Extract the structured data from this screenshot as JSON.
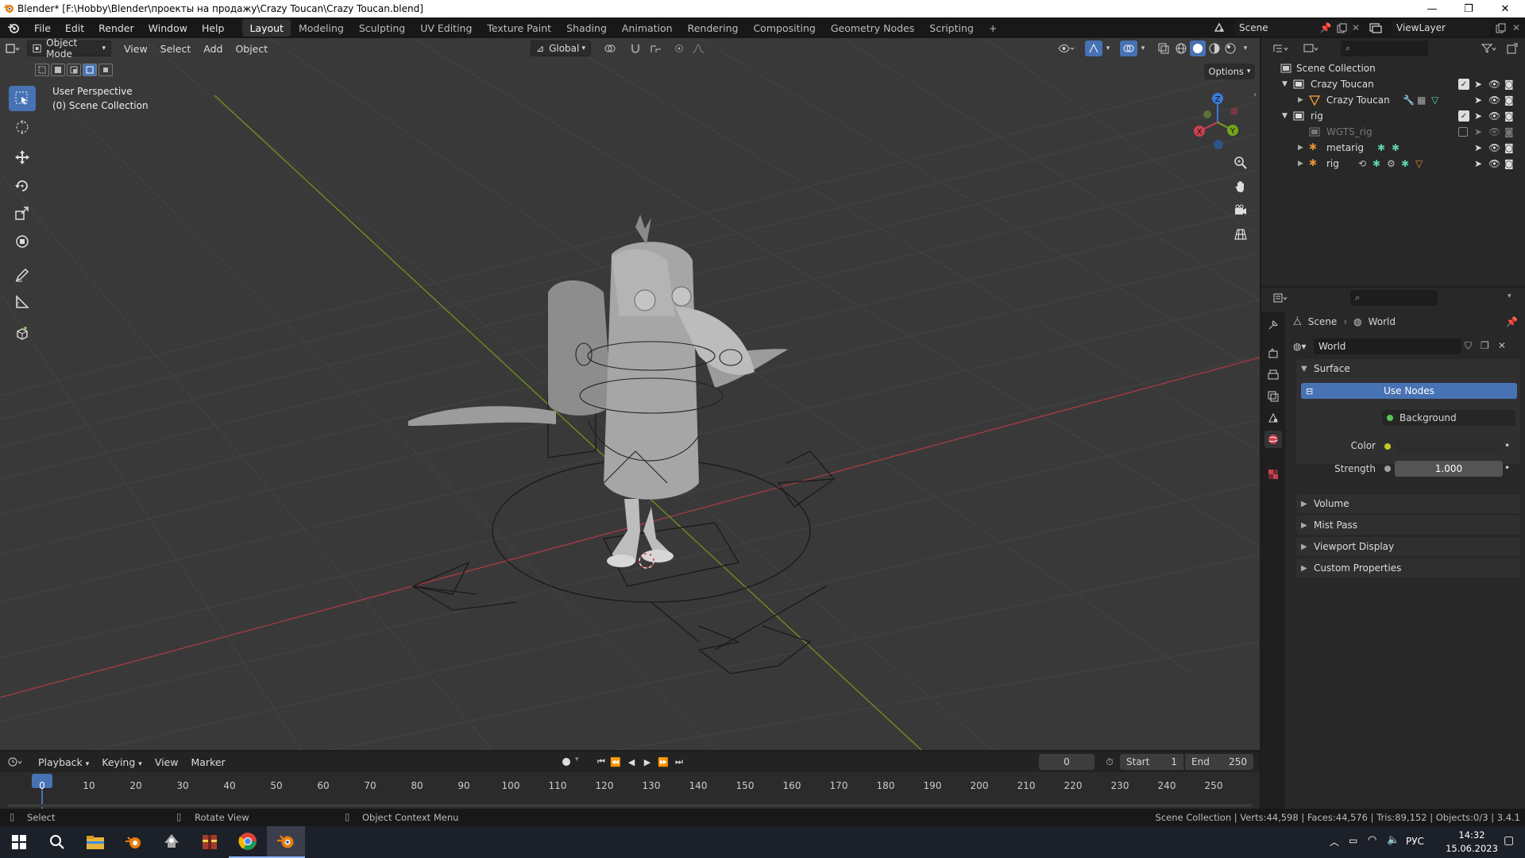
{
  "window": {
    "title": "Blender* [F:\\Hobby\\Blender\\проекты на продажу\\Crazy Toucan\\Crazy Toucan.blend]",
    "minimize": "—",
    "maximize": "❐",
    "close": "✕"
  },
  "menu": {
    "items": [
      "File",
      "Edit",
      "Render",
      "Window",
      "Help"
    ]
  },
  "workspaces": {
    "tabs": [
      "Layout",
      "Modeling",
      "Sculpting",
      "UV Editing",
      "Texture Paint",
      "Shading",
      "Animation",
      "Rendering",
      "Compositing",
      "Geometry Nodes",
      "Scripting"
    ],
    "active": "Layout",
    "add": "+"
  },
  "scene": {
    "name": "Scene"
  },
  "view_layer": {
    "name": "ViewLayer"
  },
  "viewport": {
    "mode": "Object Mode",
    "menus": [
      "View",
      "Select",
      "Add",
      "Object"
    ],
    "orientation": "Global",
    "options": "Options",
    "perspective_label": "User Perspective",
    "collection_label": "(0) Scene Collection",
    "gizmo": {
      "x": "X",
      "y": "Y",
      "z": "Z"
    }
  },
  "outliner": {
    "rows": [
      {
        "name": "Scene Collection"
      },
      {
        "name": "Crazy Toucan"
      },
      {
        "name": "Crazy Toucan"
      },
      {
        "name": "rig"
      },
      {
        "name": "WGTS_rig"
      },
      {
        "name": "metarig"
      },
      {
        "name": "rig"
      }
    ]
  },
  "properties": {
    "breadcrumb": {
      "scene": "Scene",
      "sep": "›",
      "world": "World"
    },
    "world_name": "World",
    "surface_panel": "Surface",
    "use_nodes": "Use Nodes",
    "surface_label": "Surface",
    "surface_value": "Background",
    "color_label": "Color",
    "strength_label": "Strength",
    "strength_value": "1.000",
    "panels": [
      "Volume",
      "Mist Pass",
      "Viewport Display",
      "Custom Properties"
    ]
  },
  "timeline": {
    "menus": [
      "Playback",
      "Keying",
      "View",
      "Marker"
    ],
    "current_frame": "0",
    "start_label": "Start",
    "start_value": "1",
    "end_label": "End",
    "end_value": "250",
    "frame_labels": [
      "0",
      "10",
      "20",
      "30",
      "40",
      "50",
      "60",
      "70",
      "80",
      "90",
      "100",
      "110",
      "120",
      "130",
      "140",
      "150",
      "160",
      "170",
      "180",
      "190",
      "200",
      "210",
      "220",
      "230",
      "240",
      "250"
    ]
  },
  "statusbar": {
    "select": "Select",
    "rotate": "Rotate View",
    "context": "Object Context Menu",
    "stats": "Scene Collection | Verts:44,598 | Faces:44,576 | Tris:89,152 | Objects:0/3 | 3.4.1"
  },
  "taskbar": {
    "lang": "РУС",
    "time": "14:32",
    "date": "15.06.2023"
  },
  "colors": {
    "accent": "#4772b3",
    "x_axis": "#c8414f",
    "y_axis": "#76a21e",
    "z_axis": "#3a7ad8",
    "viewport_bg": "#393939"
  }
}
